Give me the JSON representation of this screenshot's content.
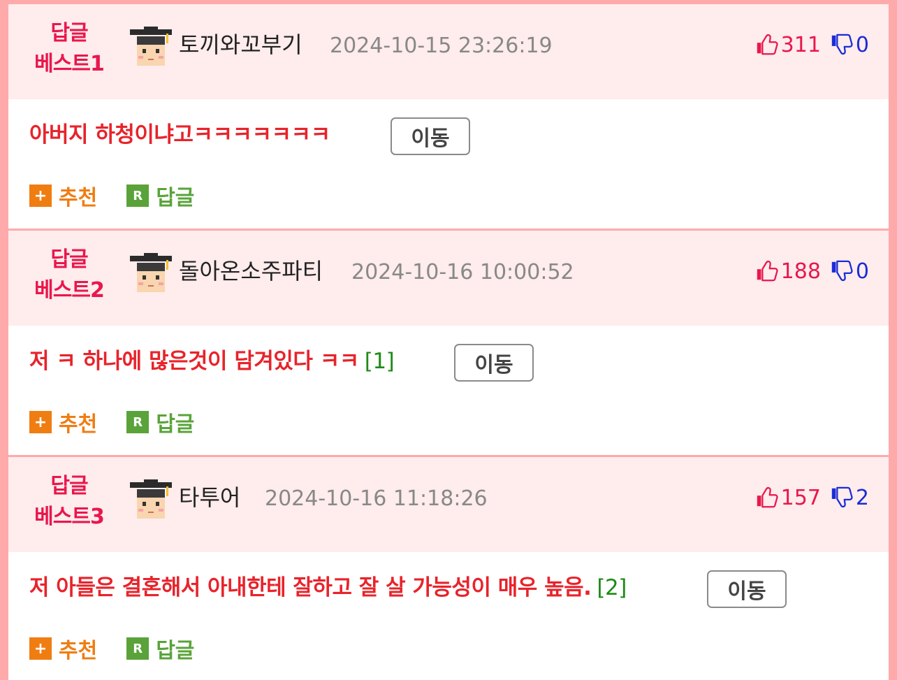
{
  "comments": [
    {
      "badge_line1": "답글",
      "badge_line2": "베스트1",
      "nickname": "토끼와꼬부기",
      "datetime": "2024-10-15 23:26:19",
      "upvotes": "311",
      "downvotes": "0",
      "text": "아버지 하청이냐고ㅋㅋㅋㅋㅋㅋㅋ",
      "reply_count": "",
      "move_label": "이동",
      "recommend_label": "추천",
      "reply_label": "답글"
    },
    {
      "badge_line1": "답글",
      "badge_line2": "베스트2",
      "nickname": "돌아온소주파티",
      "datetime": "2024-10-16 10:00:52",
      "upvotes": "188",
      "downvotes": "0",
      "text": "저 ㅋ 하나에 많은것이 담겨있다 ㅋㅋ",
      "reply_count": "[1]",
      "move_label": "이동",
      "recommend_label": "추천",
      "reply_label": "답글"
    },
    {
      "badge_line1": "답글",
      "badge_line2": "베스트3",
      "nickname": "타투어",
      "datetime": "2024-10-16 11:18:26",
      "upvotes": "157",
      "downvotes": "2",
      "text": "저 아들은 결혼해서 아내한테 잘하고 잘 살 가능성이 매우 높음.",
      "reply_count": "[2]",
      "move_label": "이동",
      "recommend_label": "추천",
      "reply_label": "답글"
    }
  ],
  "icons": {
    "avatar": "student-avatar-icon",
    "up": "thumbs-up-icon",
    "down": "thumbs-down-icon",
    "recommend": "plus-icon",
    "reply": "reply-r-icon"
  },
  "icon_glyphs": {
    "plus": "+",
    "reply": "R"
  },
  "colors": {
    "accent_pink": "#e8174d",
    "comment_red": "#e8232b",
    "down_blue": "#1a2cd6",
    "recommend_orange": "#ef7d12",
    "reply_green": "#5aa33a",
    "header_bg": "#ffecec",
    "border_pink": "#ffaaaa"
  }
}
